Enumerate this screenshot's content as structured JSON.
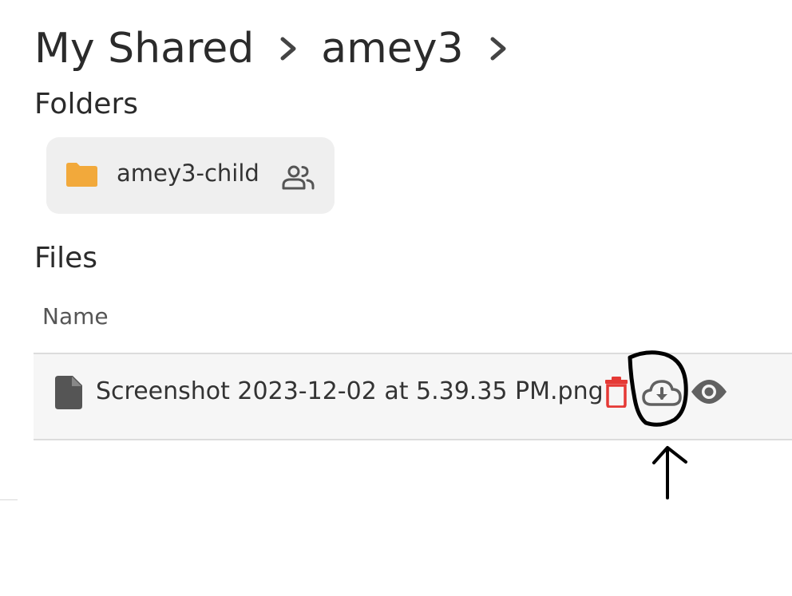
{
  "breadcrumb": {
    "items": [
      "My Shared",
      "amey3"
    ]
  },
  "folders": {
    "title": "Folders",
    "items": [
      {
        "label": "amey3-child",
        "icon": "folder-icon",
        "shared_icon": "shared-users-icon",
        "icon_color": "#F2A93B"
      }
    ]
  },
  "files": {
    "title": "Files",
    "columns": [
      "Name"
    ],
    "rows": [
      {
        "name": "Screenshot 2023-12-02 at 5.39.35 PM.png",
        "icon": "file-icon",
        "actions": [
          {
            "name": "delete",
            "icon": "trash-icon",
            "color": "#E53935"
          },
          {
            "name": "download",
            "icon": "cloud-download-icon",
            "color": "#616161"
          },
          {
            "name": "preview",
            "icon": "eye-icon",
            "color": "#616161"
          }
        ]
      }
    ]
  },
  "annotation": {
    "type": "hand-drawn circle and arrow",
    "target": "download"
  }
}
